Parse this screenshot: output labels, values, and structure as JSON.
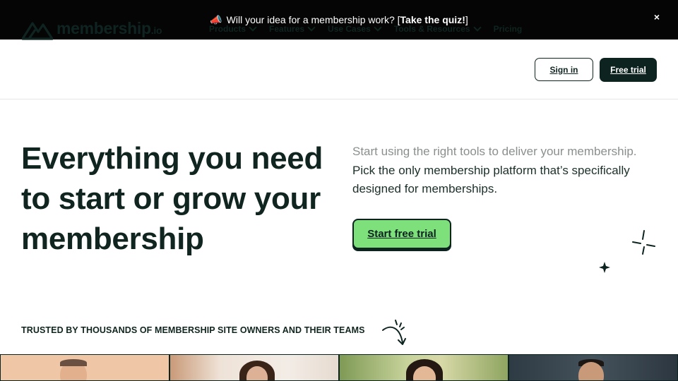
{
  "announcement": {
    "prefix": "Will your idea for a membership work? [",
    "link": "Take the quiz!",
    "suffix": "]",
    "close_label": "×"
  },
  "header": {
    "logo_text": "membership",
    "logo_suffix": ".io",
    "nav": [
      {
        "label": "Products",
        "has_dropdown": true
      },
      {
        "label": "Features",
        "has_dropdown": true
      },
      {
        "label": "Use Cases",
        "has_dropdown": true
      },
      {
        "label": "Tools & Resources",
        "has_dropdown": true
      },
      {
        "label": "Pricing",
        "has_dropdown": false
      }
    ],
    "signin_label": "Sign in",
    "free_trial_label": "Free trial"
  },
  "hero": {
    "title": "Everything you need to start or grow your membership",
    "subtitle_muted": "Start using the right tools to deliver your membership.",
    "subtitle_main": " Pick the only membership platform that’s specifically designed for memberships.",
    "cta_label": "Start free trial"
  },
  "trusted": {
    "label": "TRUSTED BY THOUSANDS OF MEMBERSHIP SITE OWNERS AND THEIR TEAMS"
  },
  "colors": {
    "announcement_bg": "#050505",
    "primary_dark": "#0c2320",
    "cta_green": "#7ee07a",
    "muted_text": "#8a8f8e"
  },
  "icons": [
    "megaphone-icon",
    "close-icon",
    "logo-mountain-icon",
    "chevron-down-icon",
    "sparkle-icon",
    "curved-arrow-icon"
  ]
}
